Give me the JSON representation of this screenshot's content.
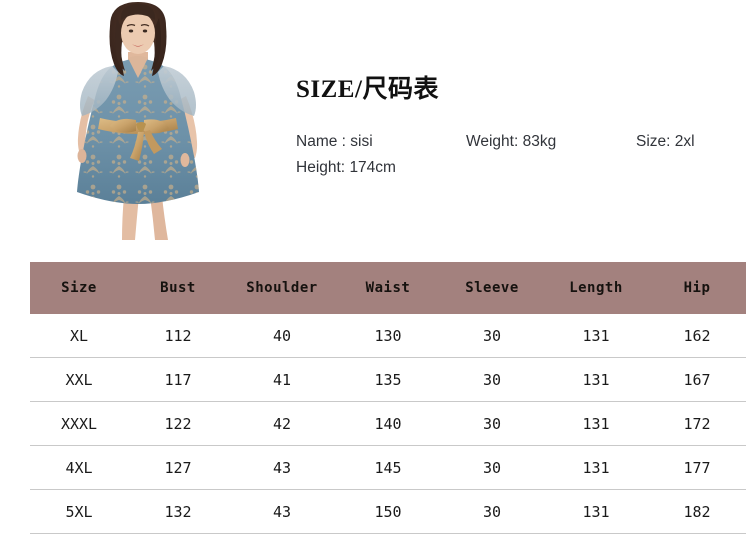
{
  "product_image": {
    "alt": "plus-size model wearing blue embroidered mesh dress with gold bow sash",
    "colors": {
      "dress_blue": "#6d91a8",
      "dress_blue_dark": "#54788f",
      "embroidery_gold": "#cdb189",
      "sash_gold": "#c9a26a",
      "sash_gold_dark": "#a57e46",
      "hair": "#402a20",
      "skin": "#e8c4aa",
      "mesh": "#b9c6cf",
      "background": "#ffffff"
    }
  },
  "info": {
    "title_latin": "SIZE/",
    "title_cjk": "尺码表",
    "name_label": "Name :",
    "name_value": "sisi",
    "weight_label": "Weight:",
    "weight_value": "83kg",
    "size_label": "Size:",
    "size_value": "2xl",
    "height_label": "Height:",
    "height_value": "174cm"
  },
  "table": {
    "header_bg": "#a3817e",
    "row_divider": "#c9c9c9",
    "columns": [
      "Size",
      "Bust",
      "Shoulder",
      "Waist",
      "Sleeve",
      "Length",
      "Hip"
    ],
    "rows": [
      [
        "XL",
        "112",
        "40",
        "130",
        "30",
        "131",
        "162"
      ],
      [
        "XXL",
        "117",
        "41",
        "135",
        "30",
        "131",
        "167"
      ],
      [
        "XXXL",
        "122",
        "42",
        "140",
        "30",
        "131",
        "172"
      ],
      [
        "4XL",
        "127",
        "43",
        "145",
        "30",
        "131",
        "177"
      ],
      [
        "5XL",
        "132",
        "43",
        "150",
        "30",
        "131",
        "182"
      ]
    ]
  }
}
